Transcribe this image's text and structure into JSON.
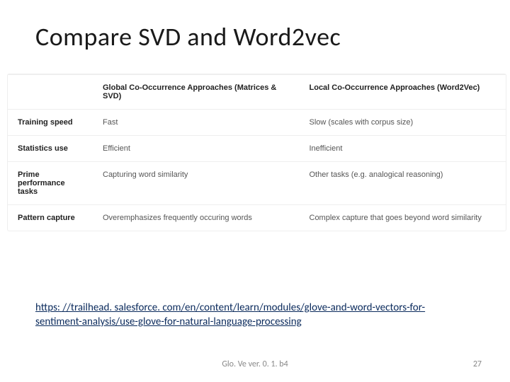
{
  "title": "Compare SVD and Word2vec",
  "table": {
    "headers": [
      "",
      "Global Co-Occurrence Approaches (Matrices & SVD)",
      "Local Co-Occurrence Approaches (Word2Vec)"
    ],
    "rows": [
      {
        "label": "Training speed",
        "c1": "Fast",
        "c2": "Slow (scales with corpus size)"
      },
      {
        "label": "Statistics use",
        "c1": "Efficient",
        "c2": "Inefficient"
      },
      {
        "label": "Prime performance tasks",
        "c1": "Capturing word similarity",
        "c2": "Other tasks (e.g. analogical reasoning)"
      },
      {
        "label": "Pattern capture",
        "c1": "Overemphasizes frequently occuring words",
        "c2": "Complex capture that goes beyond word similarity"
      }
    ]
  },
  "link": "https: //trailhead. salesforce. com/en/content/learn/modules/glove-and-word-vectors-for-sentiment-analysis/use-glove-for-natural-language-processing",
  "footer_version": "Glo. Ve ver. 0. 1. b4",
  "page_number": "27",
  "chart_data": {
    "type": "table",
    "title": "Compare SVD and Word2vec",
    "columns": [
      "",
      "Global Co-Occurrence Approaches (Matrices & SVD)",
      "Local Co-Occurrence Approaches (Word2Vec)"
    ],
    "rows": [
      [
        "Training speed",
        "Fast",
        "Slow (scales with corpus size)"
      ],
      [
        "Statistics use",
        "Efficient",
        "Inefficient"
      ],
      [
        "Prime performance tasks",
        "Capturing word similarity",
        "Other tasks (e.g. analogical reasoning)"
      ],
      [
        "Pattern capture",
        "Overemphasizes frequently occuring words",
        "Complex capture that goes beyond word similarity"
      ]
    ]
  }
}
